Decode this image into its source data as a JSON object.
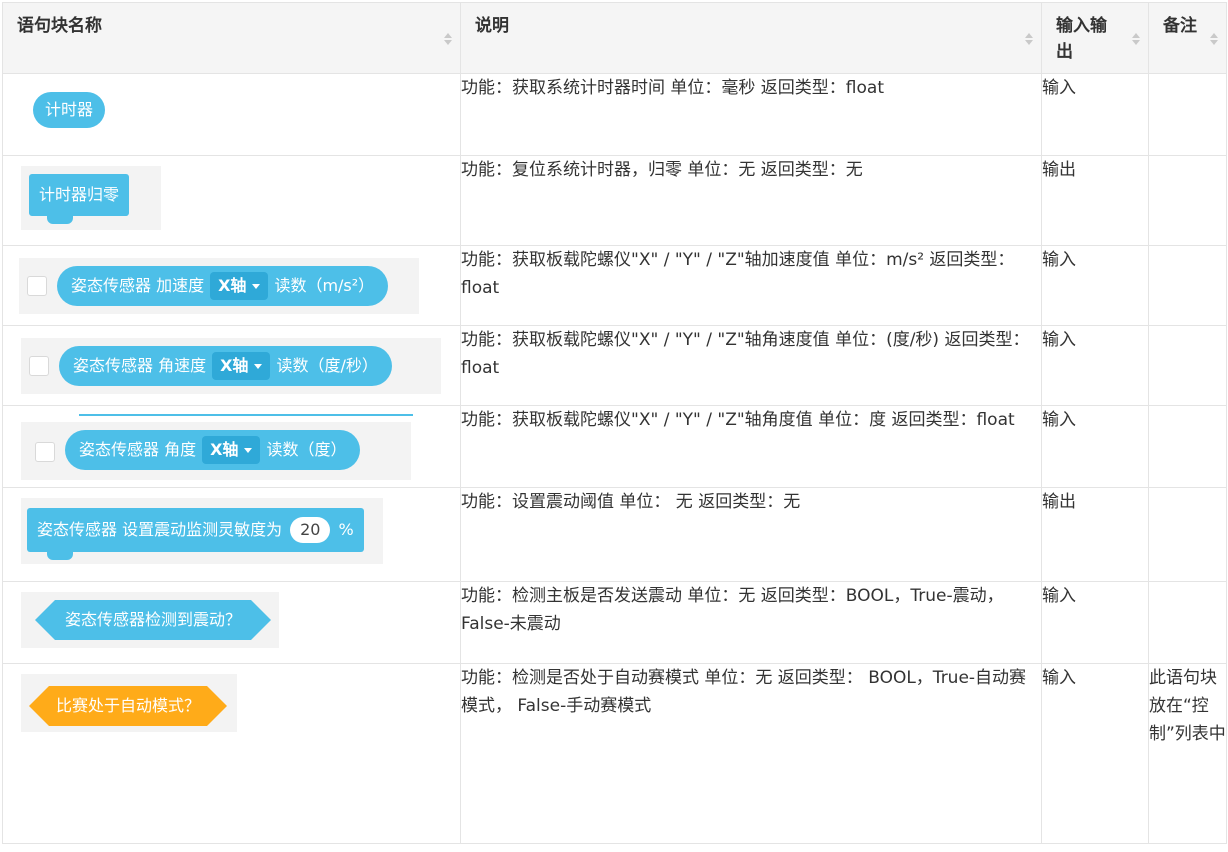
{
  "headers": {
    "name": "语句块名称",
    "desc": "说明",
    "io": "输入输出",
    "note": "备注"
  },
  "rows": [
    {
      "block": "计时器",
      "desc": "功能：获取系统计时器时间 单位：毫秒 返回类型：float",
      "io": "输入",
      "note": ""
    },
    {
      "block": "计时器归零",
      "desc": "功能：复位系统计时器，归零 单位：无 返回类型：无",
      "io": "输出",
      "note": ""
    },
    {
      "block_prefix": "姿态传感器 加速度",
      "dropdown": "X轴",
      "block_suffix": "读数（m/s²）",
      "desc": "功能：获取板载陀螺仪\"X\" / \"Y\" / \"Z\"轴加速度值 单位：m/s² 返回类型：float",
      "io": "输入",
      "note": ""
    },
    {
      "block_prefix": "姿态传感器 角速度",
      "dropdown": "X轴",
      "block_suffix": "读数（度/秒）",
      "desc": "功能：获取板载陀螺仪\"X\" / \"Y\" / \"Z\"轴角速度值  单位：(度/秒) 返回类型：float",
      "io": "输入",
      "note": ""
    },
    {
      "block_prefix": "姿态传感器 角度",
      "dropdown": "X轴",
      "block_suffix": "读数（度）",
      "desc": "功能：获取板载陀螺仪\"X\" / \"Y\" / \"Z\"轴角度值  单位：度 返回类型：float",
      "io": "输入",
      "note": ""
    },
    {
      "block_prefix": "姿态传感器 设置震动监测灵敏度为",
      "value": "20",
      "block_suffix": "%",
      "desc": "功能：设置震动阈值 单位： 无 返回类型：无",
      "io": "输出",
      "note": ""
    },
    {
      "block": "姿态传感器检测到震动？",
      "desc": "功能：检测主板是否发送震动 单位：无 返回类型：BOOL，True-震动， False-未震动",
      "io": "输入",
      "note": ""
    },
    {
      "block": "比赛处于自动模式？",
      "desc": "功能：检测是否处于自动赛模式 单位：无 返回类型： BOOL，True-自动赛模式， False-手动赛模式",
      "io": "输入",
      "note": "此语句块放在“控制”列表中"
    }
  ],
  "colors": {
    "block_blue": "#4dbfe8",
    "block_orange": "#ffab19",
    "header_bg": "#f5f5f5"
  }
}
